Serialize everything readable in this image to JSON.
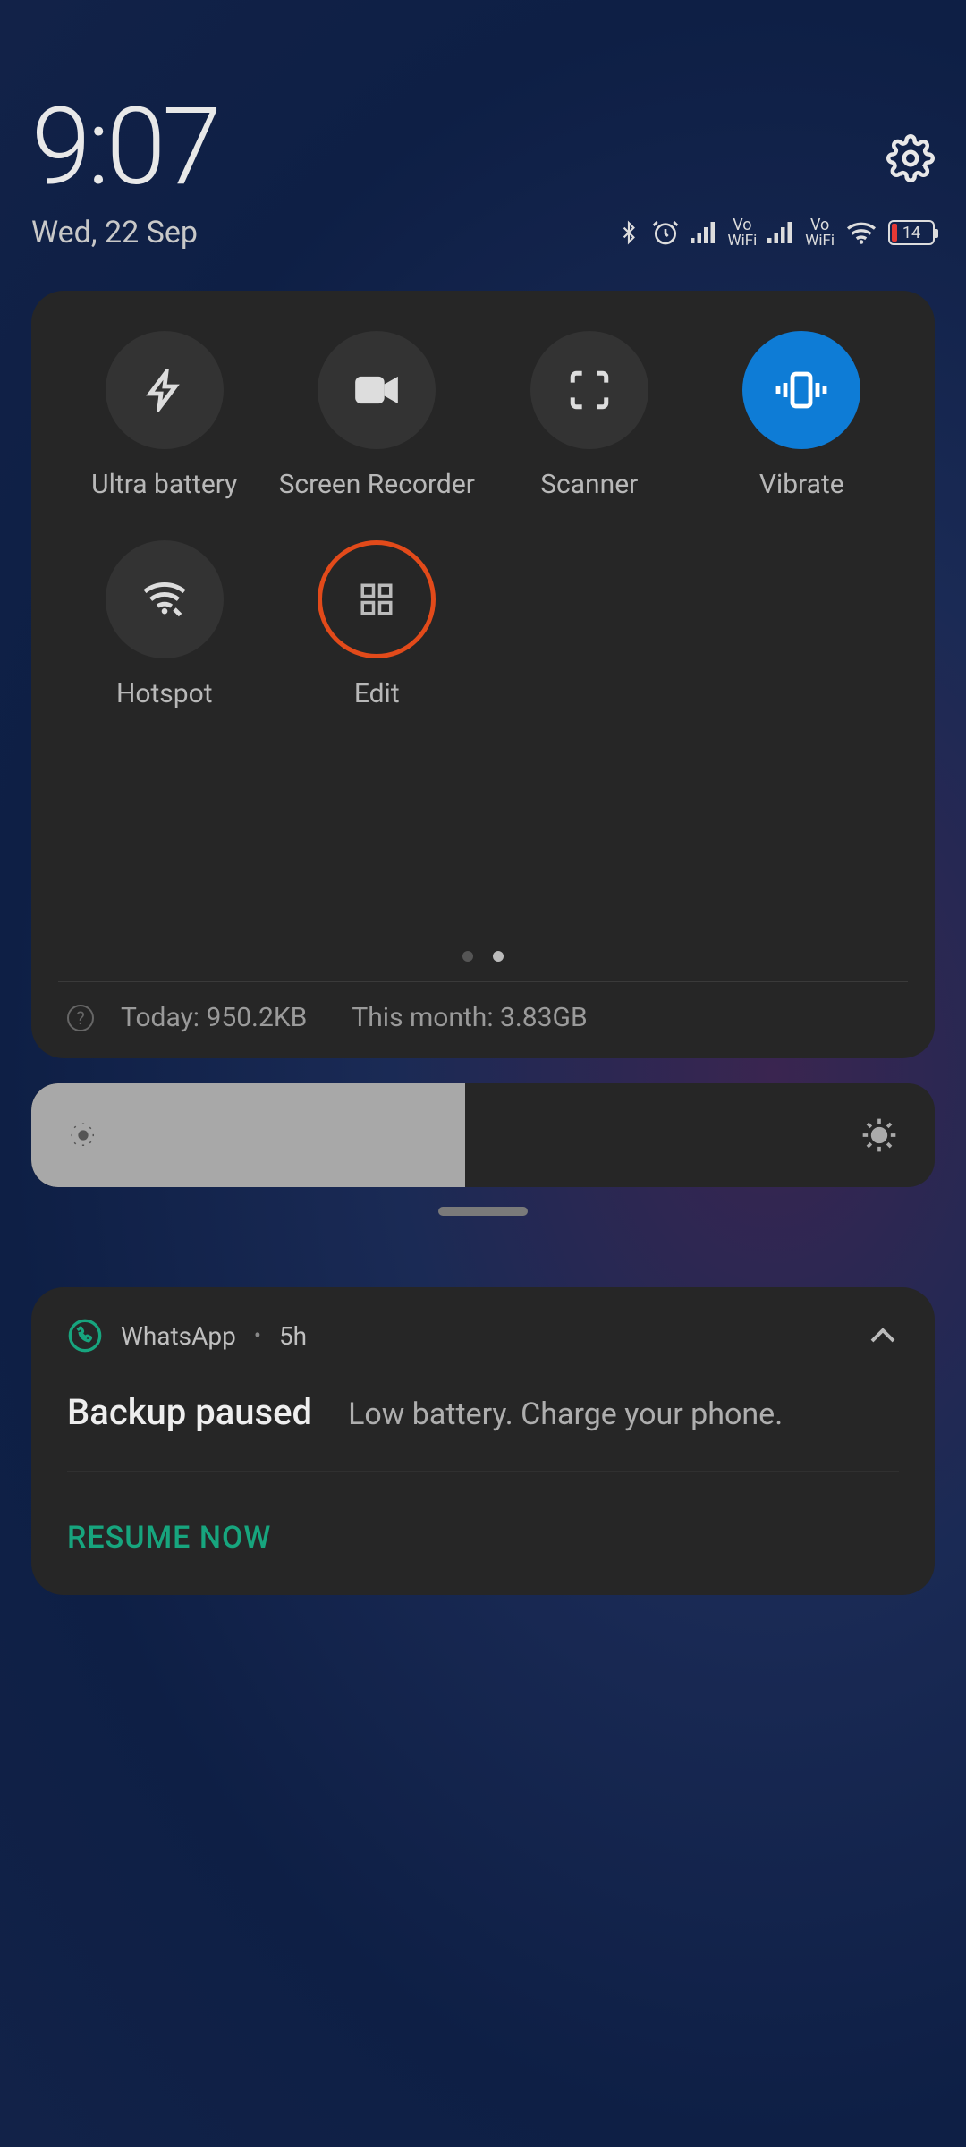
{
  "clock": "9:07",
  "date": "Wed, 22 Sep",
  "status": {
    "vowifi1_top": "Vo",
    "vowifi1_bot": "WiFi",
    "vowifi2_top": "Vo",
    "vowifi2_bot": "WiFi",
    "battery_pct": "14"
  },
  "tiles": [
    {
      "label": "Ultra battery",
      "icon": "bolt",
      "state": "off"
    },
    {
      "label": "Screen Recorder",
      "icon": "video",
      "state": "off"
    },
    {
      "label": "Scanner",
      "icon": "scan",
      "state": "off"
    },
    {
      "label": "Vibrate",
      "icon": "vibrate",
      "state": "on"
    },
    {
      "label": "Hotspot",
      "icon": "hotspot",
      "state": "off"
    },
    {
      "label": "Edit",
      "icon": "grid",
      "state": "edit"
    }
  ],
  "usage": {
    "today": "Today: 950.2KB",
    "month": "This month: 3.83GB"
  },
  "brightness_pct": 48,
  "notification": {
    "app": "WhatsApp",
    "time": "5h",
    "title": "Backup paused",
    "message": "Low battery. Charge your phone.",
    "action": "RESUME NOW"
  }
}
